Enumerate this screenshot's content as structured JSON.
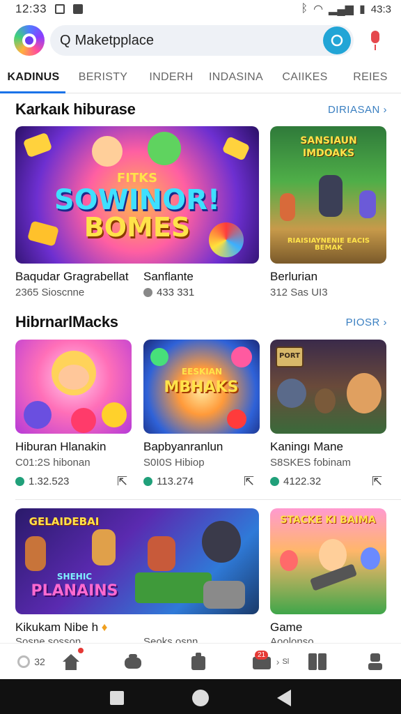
{
  "status_bar": {
    "time": "12:33",
    "right_text": "43:3"
  },
  "search": {
    "value": "Maketpplace",
    "q_glyph": "Q"
  },
  "tabs": [
    {
      "label": "KADINUS",
      "active": true
    },
    {
      "label": "BERISTY",
      "active": false
    },
    {
      "label": "INDERH",
      "active": false
    },
    {
      "label": "INDASINA",
      "active": false
    },
    {
      "label": "CAIIKES",
      "active": false
    },
    {
      "label": "REIES",
      "active": false
    }
  ],
  "section1": {
    "title": "Karkaık hiburase",
    "more": "DIRIASAN",
    "cards": [
      {
        "art_text_top": "FITKS",
        "art_text": "SOWINOR!",
        "art_text2": "BOMES",
        "title": "Baqudar Gragrabellat",
        "sub": "2365 Sioscnne"
      },
      {
        "art_text": "SANSIAUN",
        "art_text2": "IMDOAKS",
        "art_caption": "RIAISIAYNENIE EACIS BEMAK",
        "title": "Sanflante",
        "sub": "433 331"
      },
      {
        "title": "Berlurian",
        "sub": "312 Sas UI3"
      }
    ]
  },
  "section2": {
    "title": "HibrnarlMacks",
    "more": "PIOSR",
    "cards": [
      {
        "title": "Hiburan Hlanakin",
        "sub": "C01:2S hibonan",
        "rating": "1.32.523"
      },
      {
        "art_text": "MBHAKS",
        "art_text_top": "EESKIAN",
        "title": "Bapbyanranlun",
        "sub": "S0I0S Hibiop",
        "rating": "113.274"
      },
      {
        "art_text": "PORT",
        "title": "Kaningı Mane",
        "sub": "S8SKES fobinam",
        "rating": "4122.32"
      }
    ]
  },
  "section3": {
    "cards": [
      {
        "art_text_top": "GELAIDEBAI",
        "art_text_mid": "SHEHIC",
        "art_text": "PLANAINS",
        "title": "Kikukam Nibe h",
        "sub": "Sosne sosson"
      },
      {
        "art_text": "STACKE KI BAIMA",
        "title": "Game",
        "sub": "Aoolonso"
      }
    ]
  },
  "secondary_sub": "Seoks osnn",
  "bottom_nav": {
    "item1": "32",
    "badge": "21",
    "item5_suffix": "Sl"
  },
  "colors": {
    "accent": "#1a73e8",
    "link": "#3a7fc1",
    "rating_green": "#20a07a"
  }
}
